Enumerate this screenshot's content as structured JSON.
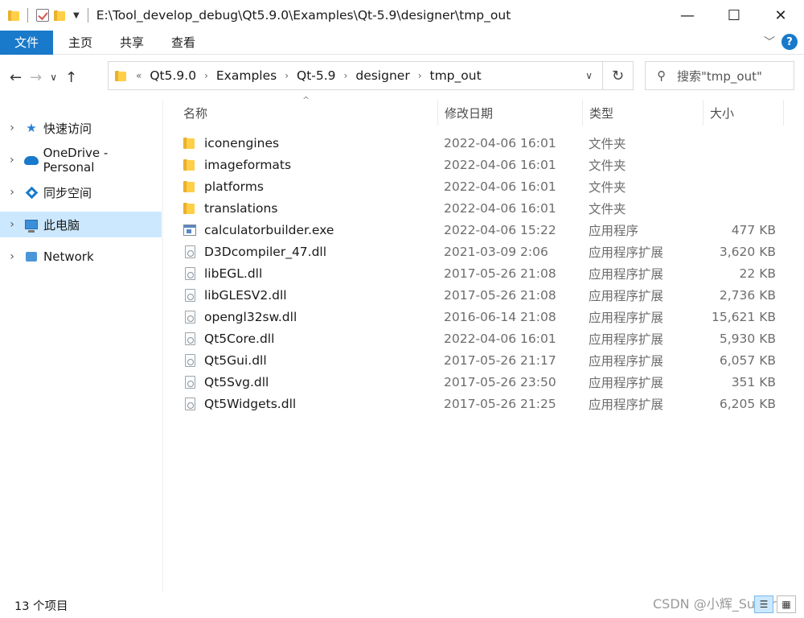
{
  "window": {
    "title_path": "E:\\Tool_develop_debug\\Qt5.9.0\\Examples\\Qt-5.9\\designer\\tmp_out",
    "minimize": "—",
    "maximize": "☐",
    "close": "✕"
  },
  "ribbon": {
    "tabs": [
      "文件",
      "主页",
      "共享",
      "查看"
    ],
    "expand_icon": "chevron-down-icon",
    "help_label": "?"
  },
  "navigation": {
    "back": "←",
    "forward": "→",
    "recent": "∨",
    "up": "↑",
    "overflow": "«",
    "breadcrumbs": [
      "Qt5.9.0",
      "Examples",
      "Qt-5.9",
      "designer",
      "tmp_out"
    ],
    "refresh": "↻",
    "search_placeholder": "搜索\"tmp_out\""
  },
  "sidebar": {
    "items": [
      {
        "label": "快速访问",
        "icon": "star-icon",
        "selected": false
      },
      {
        "label": "OneDrive - Personal",
        "icon": "cloud-icon",
        "selected": false
      },
      {
        "label": "同步空间",
        "icon": "sync-space-icon",
        "selected": false
      },
      {
        "label": "此电脑",
        "icon": "computer-icon",
        "selected": true
      },
      {
        "label": "Network",
        "icon": "network-icon",
        "selected": false
      }
    ]
  },
  "columns": {
    "name": "名称",
    "date": "修改日期",
    "type": "类型",
    "size": "大小"
  },
  "files": [
    {
      "name": "iconengines",
      "date": "2022-04-06 16:01",
      "type": "文件夹",
      "size": "",
      "icon": "folder-icon"
    },
    {
      "name": "imageformats",
      "date": "2022-04-06 16:01",
      "type": "文件夹",
      "size": "",
      "icon": "folder-icon"
    },
    {
      "name": "platforms",
      "date": "2022-04-06 16:01",
      "type": "文件夹",
      "size": "",
      "icon": "folder-icon"
    },
    {
      "name": "translations",
      "date": "2022-04-06 16:01",
      "type": "文件夹",
      "size": "",
      "icon": "folder-icon"
    },
    {
      "name": "calculatorbuilder.exe",
      "date": "2022-04-06 15:22",
      "type": "应用程序",
      "size": "477 KB",
      "icon": "exe-icon"
    },
    {
      "name": "D3Dcompiler_47.dll",
      "date": "2021-03-09 2:06",
      "type": "应用程序扩展",
      "size": "3,620 KB",
      "icon": "dll-icon"
    },
    {
      "name": "libEGL.dll",
      "date": "2017-05-26 21:08",
      "type": "应用程序扩展",
      "size": "22 KB",
      "icon": "dll-icon"
    },
    {
      "name": "libGLESV2.dll",
      "date": "2017-05-26 21:08",
      "type": "应用程序扩展",
      "size": "2,736 KB",
      "icon": "dll-icon"
    },
    {
      "name": "opengl32sw.dll",
      "date": "2016-06-14 21:08",
      "type": "应用程序扩展",
      "size": "15,621 KB",
      "icon": "dll-icon"
    },
    {
      "name": "Qt5Core.dll",
      "date": "2022-04-06 16:01",
      "type": "应用程序扩展",
      "size": "5,930 KB",
      "icon": "dll-icon"
    },
    {
      "name": "Qt5Gui.dll",
      "date": "2017-05-26 21:17",
      "type": "应用程序扩展",
      "size": "6,057 KB",
      "icon": "dll-icon"
    },
    {
      "name": "Qt5Svg.dll",
      "date": "2017-05-26 23:50",
      "type": "应用程序扩展",
      "size": "351 KB",
      "icon": "dll-icon"
    },
    {
      "name": "Qt5Widgets.dll",
      "date": "2017-05-26 21:25",
      "type": "应用程序扩展",
      "size": "6,205 KB",
      "icon": "dll-icon"
    }
  ],
  "status": {
    "item_count": "13 个项目",
    "watermark": "CSDN @小辉_Super"
  },
  "colors": {
    "accent": "#1979ca",
    "selection": "#cce8ff",
    "secondary_text": "#6d6d6d"
  }
}
